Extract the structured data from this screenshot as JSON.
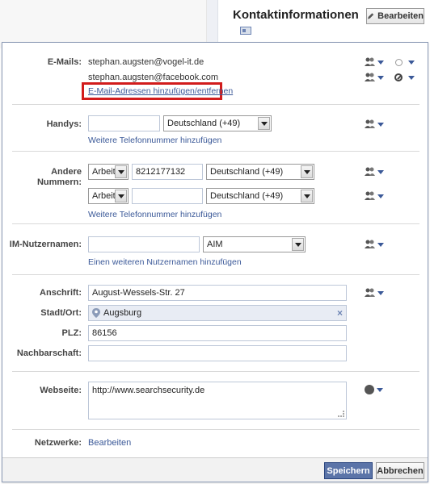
{
  "page": {
    "title": "Kontaktinformationen",
    "edit_button": "Bearbeiten"
  },
  "emails": {
    "label": "E-Mails:",
    "items": [
      "stephan.augsten@vogel-it.de",
      "stephan.augsten@facebook.com"
    ],
    "manage_link": "E-Mail-Adressen hinzufügen/entfernen"
  },
  "mobile": {
    "label": "Handys:",
    "number": "",
    "country": "Deutschland (+49)",
    "add_link": "Weitere Telefonnummer hinzufügen"
  },
  "other_numbers": {
    "label": "Andere Nummern:",
    "rows": [
      {
        "type": "Arbeit",
        "number": "8212177132",
        "country": "Deutschland (+49)"
      },
      {
        "type": "Arbeit",
        "number": "",
        "country": "Deutschland (+49)"
      }
    ],
    "add_link": "Weitere Telefonnummer hinzufügen"
  },
  "im": {
    "label": "IM-Nutzernamen:",
    "username": "",
    "service": "AIM",
    "add_link": "Einen weiteren Nutzernamen hinzufügen"
  },
  "address": {
    "street_label": "Anschrift:",
    "street": "August-Wessels-Str. 27",
    "city_label": "Stadt/Ort:",
    "city": "Augsburg",
    "zip_label": "PLZ:",
    "zip": "86156",
    "neighborhood_label": "Nachbarschaft:",
    "neighborhood": ""
  },
  "website": {
    "label": "Webseite:",
    "value": "http://www.searchsecurity.de"
  },
  "networks": {
    "label": "Netzwerke:",
    "link": "Bearbeiten"
  },
  "footer": {
    "save": "Speichern",
    "cancel": "Abbrechen"
  },
  "colors": {
    "link": "#3b5998",
    "highlight": "#d21c1c",
    "save_bg": "#5b74a8"
  }
}
